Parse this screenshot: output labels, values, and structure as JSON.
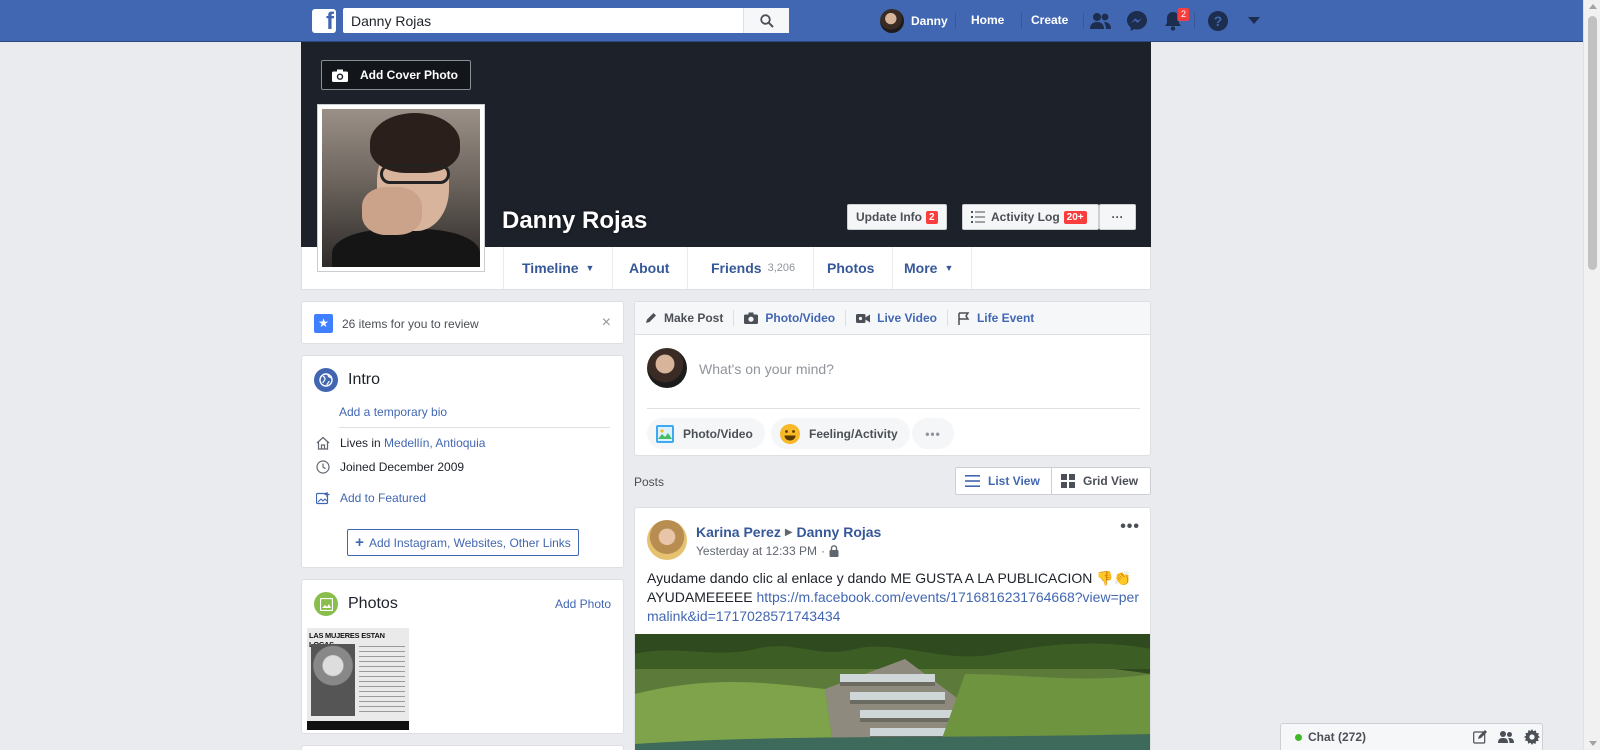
{
  "topbar": {
    "search_value": "Danny Rojas",
    "user_name": "Danny",
    "home_label": "Home",
    "create_label": "Create",
    "notifications_count": "2",
    "icons": [
      "friend-requests-icon",
      "messenger-icon",
      "notifications-icon",
      "help-icon",
      "account-menu-icon"
    ]
  },
  "cover": {
    "add_cover_label": "Add Cover Photo",
    "profile_name": "Danny Rojas",
    "update_info_label": "Update Info",
    "update_info_badge": "2",
    "activity_log_label": "Activity Log",
    "activity_log_badge": "20+",
    "more_label": "···"
  },
  "tabs": [
    {
      "label": "Timeline",
      "caret": "▼"
    },
    {
      "label": "About"
    },
    {
      "label": "Friends",
      "count": "3,206"
    },
    {
      "label": "Photos"
    },
    {
      "label": "More",
      "caret": "▼"
    }
  ],
  "review": {
    "text": "26 items for you to review",
    "close": "×"
  },
  "intro": {
    "title": "Intro",
    "bio_link": "Add a temporary bio",
    "lives_prefix": "Lives in ",
    "lives_place": "Medellín, Antioquia",
    "joined": "Joined December 2009",
    "add_featured": "Add to Featured",
    "add_links": "Add Instagram, Websites, Other Links"
  },
  "photos": {
    "title": "Photos",
    "add_label": "Add Photo",
    "thumb_heading": "LAS MUJERES ESTAN LOCAS"
  },
  "composer": {
    "tabs": [
      "Make Post",
      "Photo/Video",
      "Live Video",
      "Life Event"
    ],
    "placeholder": "What's on your mind?",
    "actions": [
      "Photo/Video",
      "Feeling/Activity"
    ],
    "more": "•••"
  },
  "posts_header": {
    "label": "Posts",
    "list_view": "List View",
    "grid_view": "Grid View"
  },
  "post": {
    "author": "Karina Perez",
    "target": "Danny Rojas",
    "time": "Yesterday at 12:33 PM",
    "dot": "·",
    "more": "•••",
    "text": "Ayudame dando clic al enlace y dando ME GUSTA A LA PUBLICACION 👎👏 AYUDAMEEEEE ",
    "link": "https://m.facebook.com/events/1716816231764668?view=permalink&id=1717028571743434"
  },
  "chat": {
    "label": "Chat (272)"
  },
  "colors": {
    "brand": "#4267b2",
    "badge": "#fa3e3e",
    "online": "#42b72a"
  }
}
